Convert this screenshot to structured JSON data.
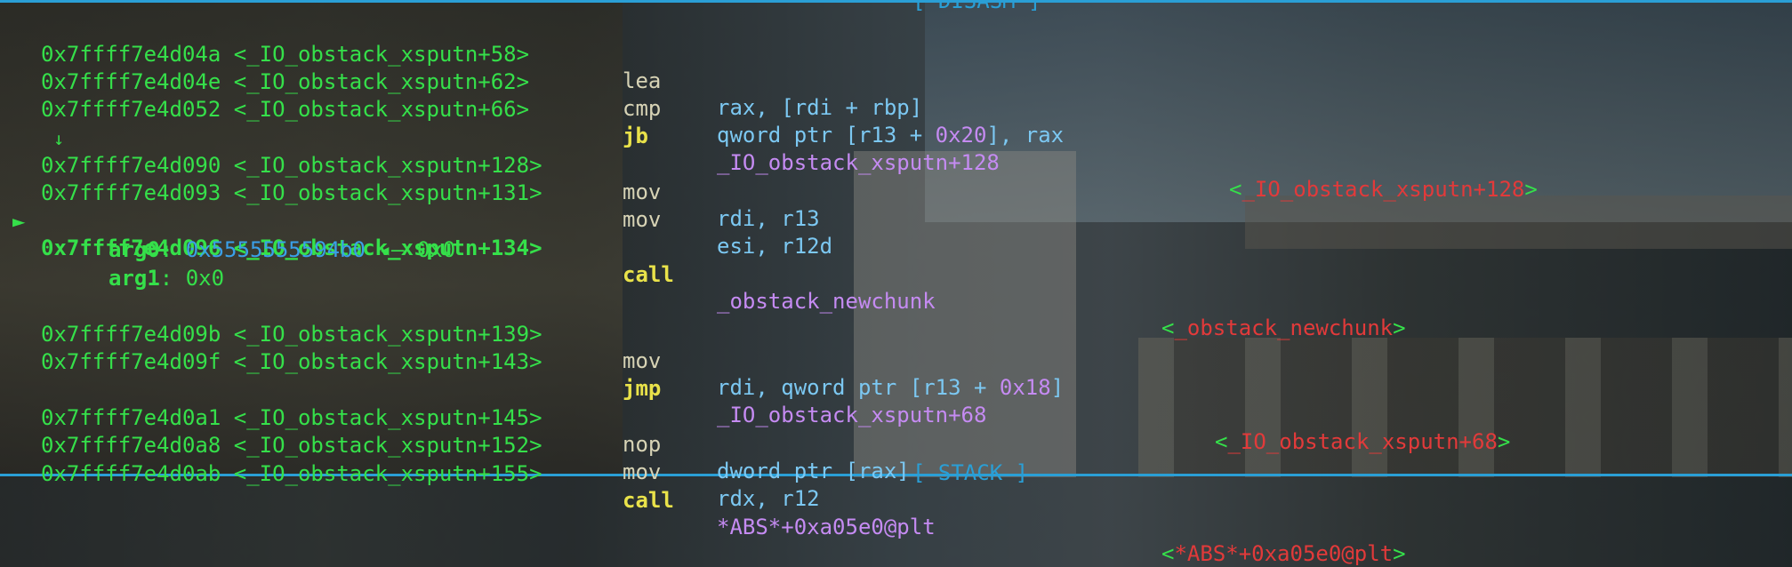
{
  "header": {
    "title": "[ DISASM ]"
  },
  "footer": {
    "title": "[ STACK ]"
  },
  "colors": {
    "border": "#2a9fd6",
    "address": "#35e04a",
    "jump_mnemonic": "#e9e24a",
    "register": "#7cc8f2",
    "number": "#c58bf2",
    "symbol_comment": "#e23a3a"
  },
  "lines": [
    {
      "address": "0x7ffff7e4d04a <_IO_obstack_xsputn+58>",
      "mnemonic": "lea",
      "operands": "rax, [rdi + rbp]"
    },
    {
      "address": "0x7ffff7e4d04e <_IO_obstack_xsputn+62>",
      "mnemonic": "cmp",
      "operands_pre": "qword ptr [r13 + ",
      "operands_num": "0x20",
      "operands_post": "], rax"
    },
    {
      "address": "0x7ffff7e4d052 <_IO_obstack_xsputn+66>",
      "mnemonic": "jb",
      "operands": "_IO_obstack_xsputn+128",
      "comment": "_IO_obstack_xsputn+128"
    },
    {
      "address": "0x7ffff7e4d090 <_IO_obstack_xsputn+128>",
      "mnemonic": "mov",
      "operands": "rdi, r13"
    },
    {
      "address": "0x7ffff7e4d093 <_IO_obstack_xsputn+131>",
      "mnemonic": "mov",
      "operands": "esi, r12d"
    },
    {
      "address": "0x7ffff7e4d096 <_IO_obstack_xsputn+134>",
      "mnemonic": "call",
      "operands": "_obstack_newchunk",
      "comment": "_obstack_newchunk"
    },
    {
      "address": "0x7ffff7e4d09b <_IO_obstack_xsputn+139>",
      "mnemonic": "mov",
      "operands_pre": "rdi, qword ptr [r13 + ",
      "operands_num": "0x18",
      "operands_post": "]"
    },
    {
      "address": "0x7ffff7e4d09f <_IO_obstack_xsputn+143>",
      "mnemonic": "jmp",
      "operands": "_IO_obstack_xsputn+68",
      "comment": "_IO_obstack_xsputn+68"
    },
    {
      "address": "0x7ffff7e4d0a1 <_IO_obstack_xsputn+145>",
      "mnemonic": "nop",
      "operands": "dword ptr [rax]"
    },
    {
      "address": "0x7ffff7e4d0a8 <_IO_obstack_xsputn+152>",
      "mnemonic": "mov",
      "operands": "rdx, r12"
    },
    {
      "address": "0x7ffff7e4d0ab <_IO_obstack_xsputn+155>",
      "mnemonic": "call",
      "operands": "*ABS*+0xa05e0@plt",
      "comment": "*ABS*+0xa05e0@plt"
    }
  ],
  "current_marker": "►",
  "jump_arrow": "↓",
  "args": [
    {
      "name": "arg0",
      "value": "0x5555555594b0",
      "arrow": "◂—",
      "deref": "0x0"
    },
    {
      "name": "arg1",
      "value": "0x0"
    }
  ],
  "bracket_open": "<",
  "bracket_close": ">"
}
